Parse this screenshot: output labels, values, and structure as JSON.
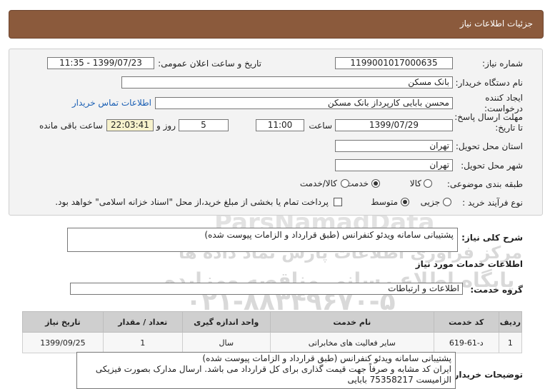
{
  "header": {
    "title": "جزئیات اطلاعات نیاز"
  },
  "fields": {
    "need_number_label": "شماره نیاز:",
    "need_number": "1199001017000635",
    "announce_label": "تاریخ و ساعت اعلان عمومی:",
    "announce_value": "1399/07/23 - 11:35",
    "buyer_org_label": "نام دستگاه خریدار:",
    "buyer_org": "بانک مسکن",
    "creator_label": "ایجاد کننده درخواست:",
    "creator": "محسن بابایی کارپرداز بانک مسکن",
    "contact_link": "اطلاعات تماس خریدار",
    "deadline_label": "مهلت ارسال پاسخ: تا تاریخ:",
    "deadline_date": "1399/07/29",
    "time_label": "ساعت",
    "deadline_time": "11:00",
    "days_value": "5",
    "days_label": "روز و",
    "remaining_time": "22:03:41",
    "remaining_label": "ساعت باقی مانده",
    "province_label": "استان محل تحویل:",
    "province": "تهران",
    "city_label": "شهر محل تحویل:",
    "city": "تهران",
    "category_label": "طبقه بندی موضوعی:",
    "category_options": [
      "کالا",
      "خدمت",
      "کالا/خدمت"
    ],
    "category_selected": "خدمت",
    "process_label": "نوع فرآیند خرید :",
    "process_options": [
      "جزیی",
      "متوسط"
    ],
    "process_selected": "متوسط",
    "treasury_note": "پرداخت تمام یا بخشی از مبلغ خرید،از محل \"اسناد خزانه اسلامی\" خواهد بود."
  },
  "summary": {
    "label": "شرح کلی نیاز:",
    "value": "پشتیبانی سامانه ویدئو کنفرانس (طبق قرارداد و الزامات پیوست شده)"
  },
  "services_section": {
    "title": "اطلاعات خدمات مورد نیاز",
    "group_label": "گروه خدمت:",
    "group_value": "اطلاعات و ارتباطات"
  },
  "table": {
    "headers": [
      "ردیف",
      "کد خدمت",
      "نام خدمت",
      "واحد اندازه گیری",
      "تعداد / مقدار",
      "تاریخ نیاز"
    ],
    "rows": [
      [
        "1",
        "د-61-619",
        "سایر فعالیت های مخابراتی",
        "سال",
        "1",
        "1399/09/25"
      ]
    ]
  },
  "buyer_notes": {
    "label": "توضیحات خریدار:",
    "lines": [
      "پشتیبانی سامانه ویدئو کنفرانس (طبق قرارداد و الزامات پیوست شده)",
      "ایران کد مشابه و صرفاً جهت قیمت گذاری برای کل قرارداد می باشد. ارسال مدارک بصورت فیزیکی",
      "الزامیست 75358217 بابایی"
    ]
  },
  "watermark": {
    "brand": "ParsNamadData",
    "line1": "مرکز فراوری اطلاعات پارس نماد داده ها",
    "line2": "پایگاه اطلاع رسانی مناقصه ومزایده",
    "phone": "۰۲۱-۸۸۳۴۹۶۷۰-۵"
  }
}
